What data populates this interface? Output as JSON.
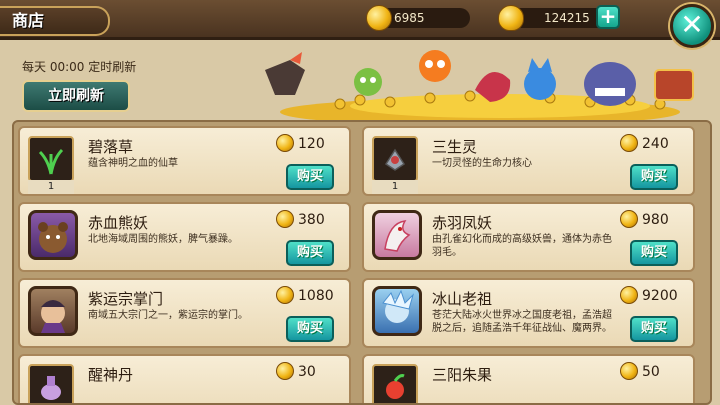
{
  "header": {
    "title": "商店",
    "coins": "6985",
    "gold": "124215",
    "add_label": "+",
    "close_label": "✕",
    "refresh_info": "每天 00:00 定时刷新",
    "refresh_button": "立即刷新",
    "buy_label": "购买"
  },
  "items": [
    {
      "name": "碧落草",
      "desc": "蕴含神明之血的仙草",
      "price": "120",
      "qty": "1",
      "icon": "herb-icon",
      "kind": "item"
    },
    {
      "name": "三生灵",
      "desc": "一切灵怪的生命力核心",
      "price": "240",
      "qty": "1",
      "icon": "core-icon",
      "kind": "item"
    },
    {
      "name": "赤血熊妖",
      "desc": "北地海域周围的熊妖，脾气暴躁。",
      "price": "380",
      "qty": "",
      "icon": "bear-portrait",
      "kind": "hero"
    },
    {
      "name": "赤羽凤妖",
      "desc": "由孔雀幻化而成的高级妖兽，通体为赤色羽毛。",
      "price": "980",
      "qty": "",
      "icon": "phoenix-portrait",
      "kind": "hero"
    },
    {
      "name": "紫运宗掌门",
      "desc": "南域五大宗门之一，紫运宗的掌门。",
      "price": "1080",
      "qty": "",
      "icon": "sect-leader-portrait",
      "kind": "hero"
    },
    {
      "name": "冰山老祖",
      "desc": "苍茫大陆冰火世界冰之国度老祖，孟浩超脱之后，追随孟浩千年征战仙、魔两界。",
      "price": "9200",
      "qty": "",
      "icon": "ice-ancestor-portrait",
      "kind": "hero"
    },
    {
      "name": "醒神丹",
      "desc": "",
      "price": "30",
      "qty": "",
      "icon": "pill-icon",
      "kind": "item"
    },
    {
      "name": "三阳朱果",
      "desc": "",
      "price": "50",
      "qty": "",
      "icon": "fruit-icon",
      "kind": "item"
    }
  ],
  "colors": {
    "accent": "#1fb8a6",
    "panel": "#f7edd6",
    "bar": "#5a3f28"
  }
}
